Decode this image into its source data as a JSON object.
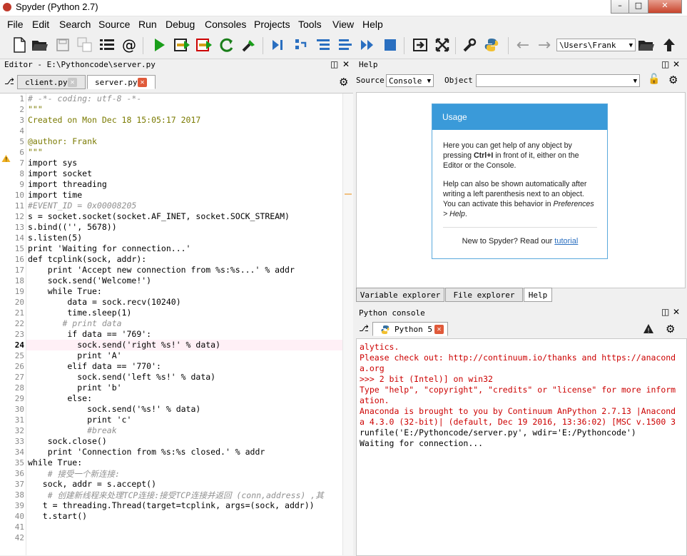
{
  "window": {
    "title": "Spyder (Python 2.7)"
  },
  "menu": [
    "File",
    "Edit",
    "Search",
    "Source",
    "Run",
    "Debug",
    "Consoles",
    "Projects",
    "Tools",
    "View",
    "Help"
  ],
  "toolbar": {
    "path_value": "\\Users\\Frank"
  },
  "editor": {
    "pane_title": "Editor - E:\\Pythoncode\\server.py",
    "tabs": [
      {
        "label": "client.py",
        "active": false
      },
      {
        "label": "server.py",
        "active": true
      }
    ],
    "current_line": 24
  },
  "code_lines": [
    "# -*- coding: utf-8 -*-",
    "\"\"\"",
    "Created on Mon Dec 18 15:05:17 2017",
    "",
    "@author: Frank",
    "\"\"\"",
    "import sys",
    "import socket",
    "import threading",
    "import time",
    "#EVENT_ID = 0x00008205",
    "s = socket.socket(socket.AF_INET, socket.SOCK_STREAM)",
    "s.bind(('', 5678))",
    "s.listen(5)",
    "print 'Waiting for connection...'",
    "def tcplink(sock, addr):",
    "    print 'Accept new connection from %s:%s...' % addr",
    "    sock.send('Welcome!')",
    "    while True:",
    "        data = sock.recv(10240)",
    "        time.sleep(1)",
    "       # print data",
    "        if data == '769':",
    "          sock.send('right %s!' % data)",
    "          print 'A'",
    "        elif data == '770':",
    "          sock.send('left %s!' % data)",
    "          print 'b'",
    "        else:",
    "            sock.send('%s!' % data)",
    "            print 'c'",
    "            #break",
    "    sock.close()",
    "    print 'Connection from %s:%s closed.' % addr",
    "while True:",
    "    # 接受一个新连接:",
    "   sock, addr = s.accept()",
    "    # 创建新线程来处理TCP连接:接受TCP连接并返回 (conn,address) ,其",
    "   t = threading.Thread(target=tcplink, args=(sock, addr))",
    "   t.start()",
    "",
    ""
  ],
  "help": {
    "pane_title": "Help",
    "source_label": "Source",
    "source_value": "Console",
    "object_label": "Object",
    "usage_title": "Usage",
    "usage_p1_a": "Here you can get help of any object by pressing ",
    "usage_p1_b": "Ctrl+I",
    "usage_p1_c": " in front of it, either on the Editor or the Console.",
    "usage_p2_a": "Help can also be shown automatically after writing a left parenthesis next to an object. You can activate this behavior in ",
    "usage_p2_b": "Preferences > Help",
    "usage_p2_c": ".",
    "new_prefix": "New to Spyder? Read our ",
    "tutorial_link": "tutorial",
    "bottom_tabs": [
      "Variable explorer",
      "File explorer",
      "Help"
    ]
  },
  "console": {
    "pane_title": "Python console",
    "tab_label": "Python 5",
    "lines": [
      {
        "text": "alytics.",
        "err": true
      },
      {
        "text": "Please check out: http://continuum.io/thanks and https://anacond",
        "err": true
      },
      {
        "text": "a.org",
        "err": true
      },
      {
        "text": ">>> 2 bit (Intel)] on win32",
        "err": true
      },
      {
        "text": "Type \"help\", \"copyright\", \"credits\" or \"license\" for more inform",
        "err": true
      },
      {
        "text": "ation.",
        "err": true
      },
      {
        "text": "Anaconda is brought to you by Continuum AnPython 2.7.13 |Anacond",
        "err": true
      },
      {
        "text": "a 4.3.0 (32-bit)| (default, Dec 19 2016, 13:36:02) [MSC v.1500 3",
        "err": true
      },
      {
        "text": "runfile('E:/Pythoncode/server.py', wdir='E:/Pythoncode')",
        "err": false
      },
      {
        "text": "Waiting for connection...",
        "err": false
      }
    ]
  },
  "colors": {
    "accent": "#3a9ad9",
    "close_tab": "#e05a3a",
    "run_green": "#1a9e1a",
    "error_text": "#cc0000"
  }
}
